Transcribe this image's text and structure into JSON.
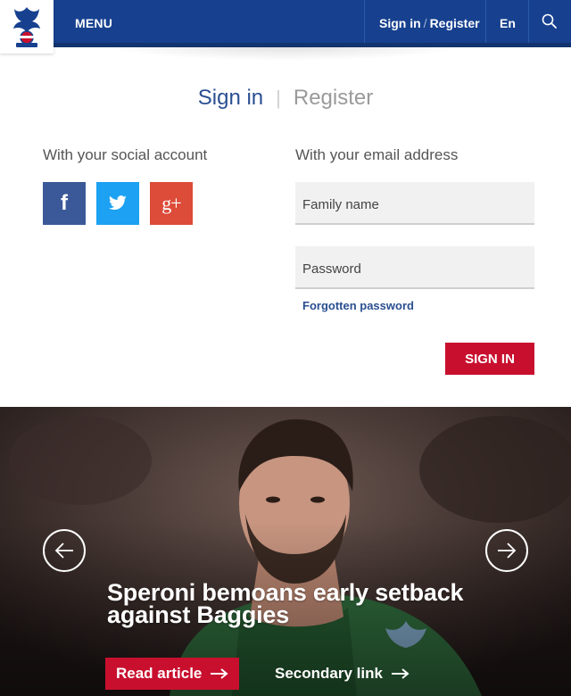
{
  "header": {
    "menu_label": "MENU",
    "signin_label": "Sign in",
    "separator": "/",
    "register_label": "Register",
    "language": "En",
    "brand_color": "#17418f",
    "search_icon": "search-icon",
    "logo_icon": "club-crest-icon"
  },
  "auth": {
    "tab_signin": "Sign in",
    "tab_separator": "|",
    "tab_register": "Register",
    "social_heading": "With your social account",
    "email_heading": "With your email address",
    "social_buttons": [
      {
        "network": "Facebook",
        "label": "f",
        "icon": "facebook-icon",
        "color": "#3b5998"
      },
      {
        "network": "Twitter",
        "icon": "twitter-icon",
        "color": "#1da1f2"
      },
      {
        "network": "Google+",
        "label": "g+",
        "icon": "google-plus-icon",
        "color": "#dd4b39"
      }
    ],
    "family_name_placeholder": "Family name",
    "password_placeholder": "Password",
    "forgot_label": "Forgotten password",
    "submit_label": "SIGN IN",
    "submit_color": "#c8102e"
  },
  "hero": {
    "headline": "Speroni bemoans early setback against Baggies",
    "primary_cta": "Read article",
    "secondary_cta": "Secondary link",
    "prev_icon": "arrow-left-icon",
    "next_icon": "arrow-right-icon"
  }
}
